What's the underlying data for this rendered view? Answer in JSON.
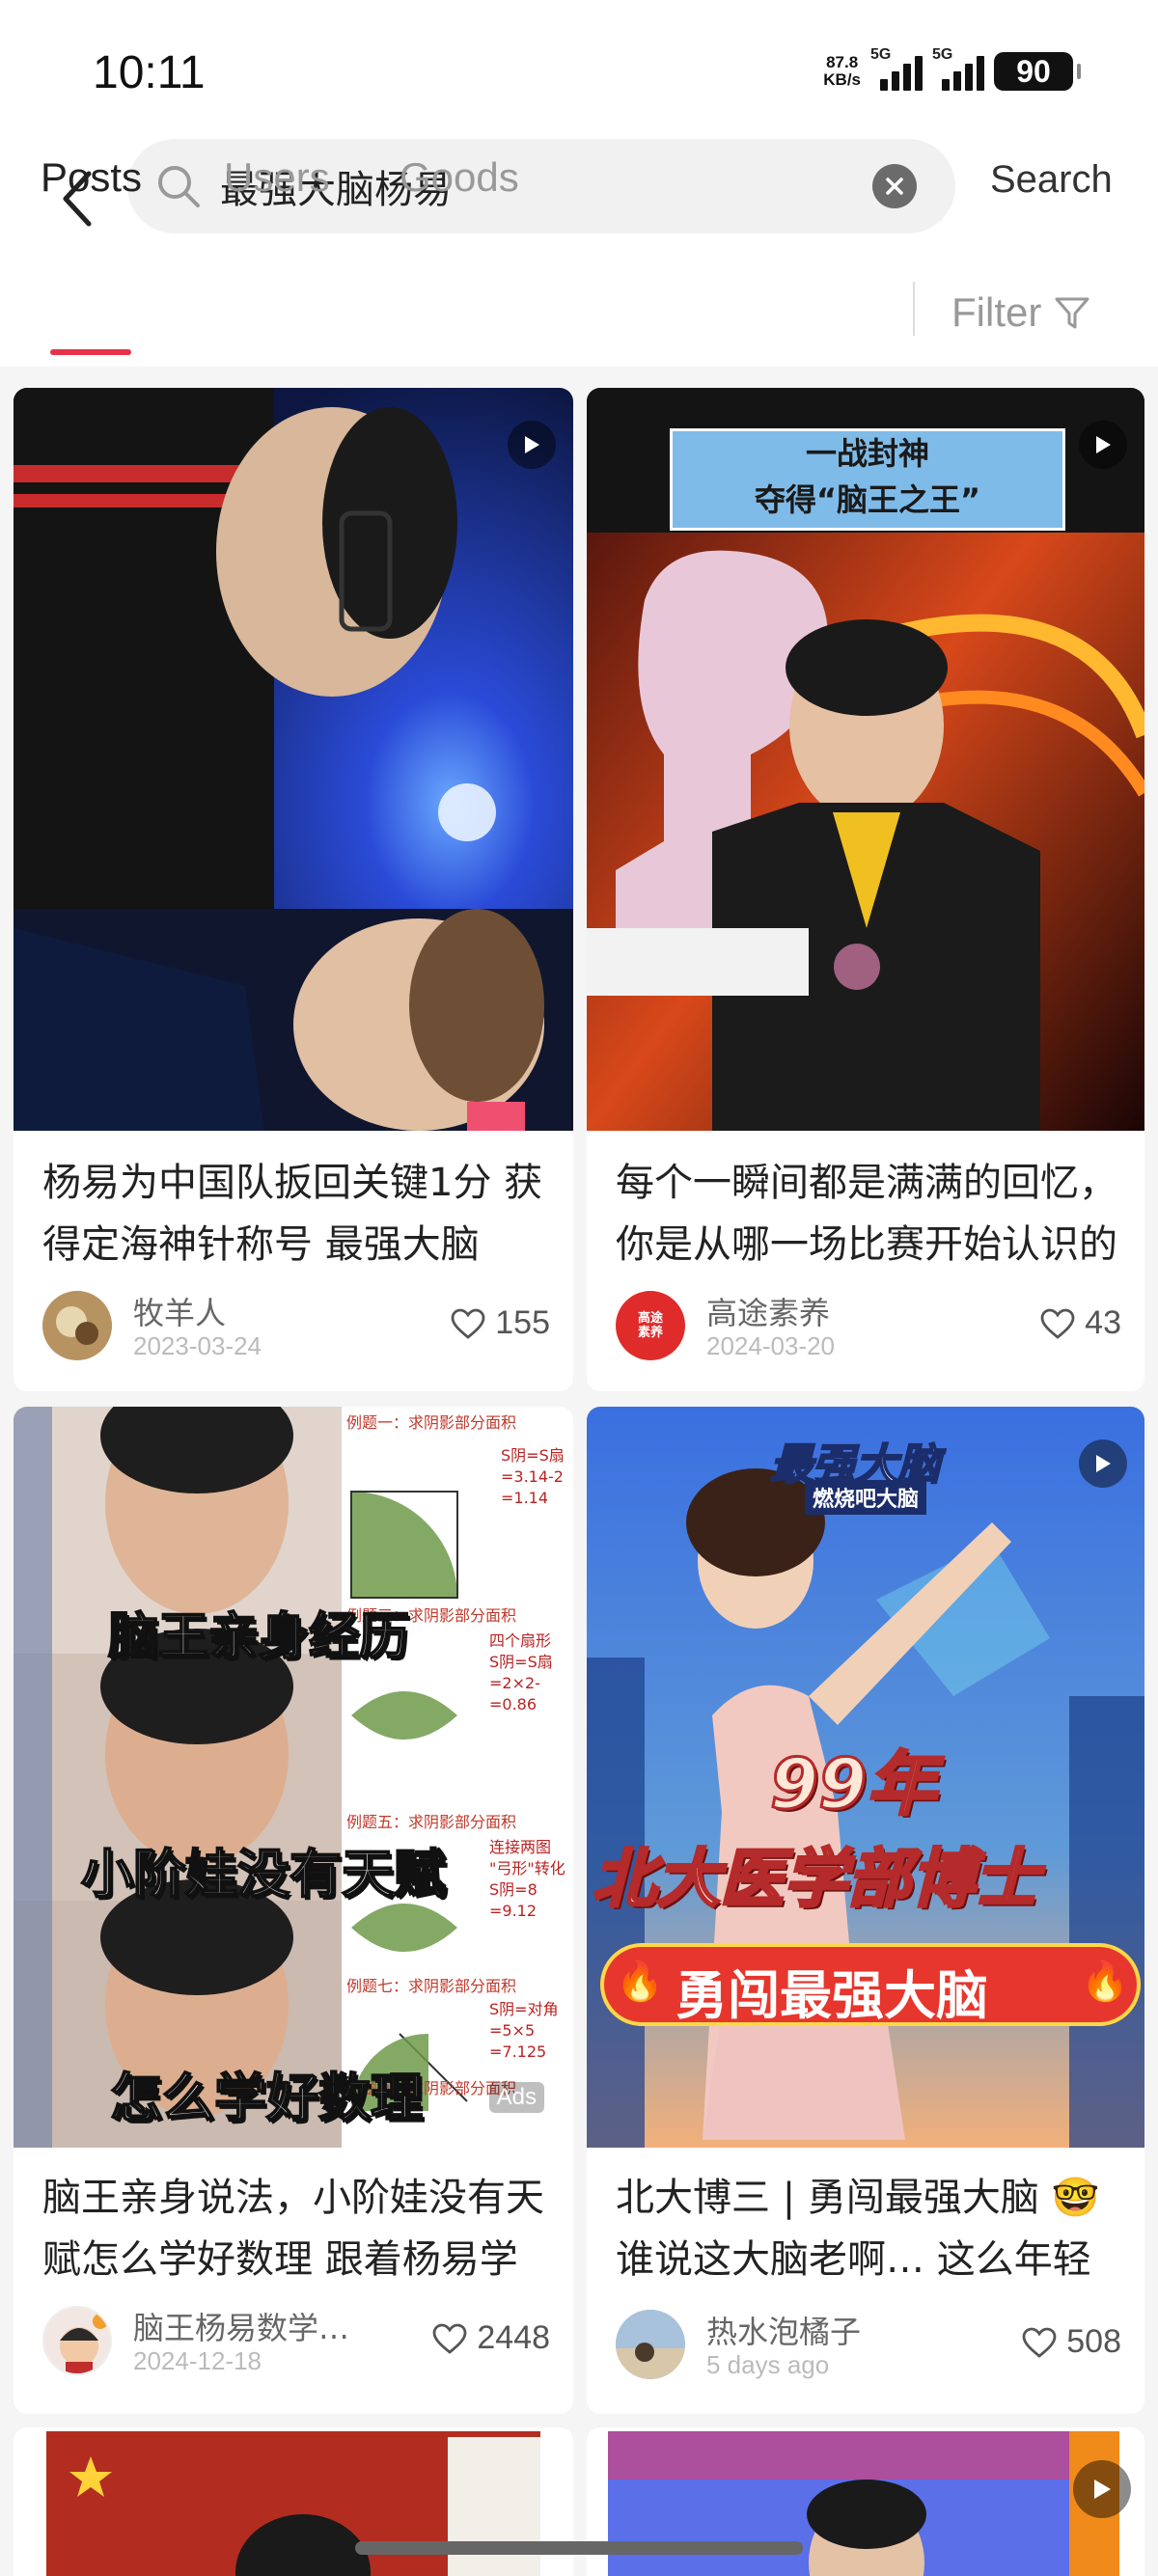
{
  "status_bar": {
    "time": "10:11",
    "net_speed_value": "87.8",
    "net_speed_unit": "KB/s",
    "signal1_label": "5G",
    "signal2_label": "5G",
    "battery": "90"
  },
  "search": {
    "query": "最强大脑杨易",
    "button_label": "Search"
  },
  "tabs": [
    {
      "label": "Posts",
      "active": true
    },
    {
      "label": "Users",
      "active": false
    },
    {
      "label": "Goods",
      "active": false
    }
  ],
  "filter_label": "Filter",
  "posts": [
    {
      "title": "杨易为中国队扳回关键1分 获得定海神针称号 最强大脑",
      "author": "牧羊人",
      "date": "2023-03-24",
      "likes": "155",
      "is_video": true
    },
    {
      "title": "每个一瞬间都是满满的回忆，你是从哪一场比赛开始认识的",
      "author": "高途素养",
      "avatar_text": "高途\n素养",
      "date": "2024-03-20",
      "likes": "43",
      "is_video": true,
      "thumb_banner_line1": "一战封神",
      "thumb_banner_line2": "夺得“脑王之王”"
    },
    {
      "title": "脑王亲身说法，小阶娃没有天赋怎么学好数理 跟着杨易学数学",
      "author": "脑王杨易数学思维",
      "date": "2024-12-18",
      "likes": "2448",
      "is_ad": true,
      "ad_label": "Ads",
      "overlay_lines": [
        "脑王亲身经历",
        "小阶娃没有天赋",
        "怎么学好数理"
      ],
      "worksheet": [
        {
          "head": "例题一：求阴影部分面积",
          "lines": [
            "S阴=S扇",
            "=3.14-2",
            "=1.14"
          ]
        },
        {
          "head": "例题三：求阴影部分面积",
          "lines": [
            "四个扇形",
            "S阴=S扇",
            "=2×2-",
            "=0.86"
          ]
        },
        {
          "head": "例题五：求阴影部分面积",
          "lines": [
            "连接两图",
            "\"弓形\"转化",
            "S阴=8",
            "=9.12"
          ]
        },
        {
          "head": "例题七：求阴影部分面积",
          "lines": [
            "S阴=对角",
            "=5×5",
            "=7.125"
          ]
        },
        {
          "head": "例题九：求阴影部分面积",
          "lines": []
        }
      ]
    },
    {
      "title": "北大博三 | 勇闯最强大脑 🤓谁说这大脑老啊… 这么年轻",
      "author": "热水泡橘子",
      "date": "5 days ago",
      "likes": "508",
      "is_video": true,
      "show_logo_line1": "最强大脑",
      "show_logo_line2": "燃烧吧大脑",
      "overlay_line1": "99年",
      "overlay_line2": "北大医学部博士",
      "overlay_pill": "勇闯最强大脑"
    }
  ],
  "colors": {
    "accent": "#e63349",
    "like_icon": "#555555"
  }
}
